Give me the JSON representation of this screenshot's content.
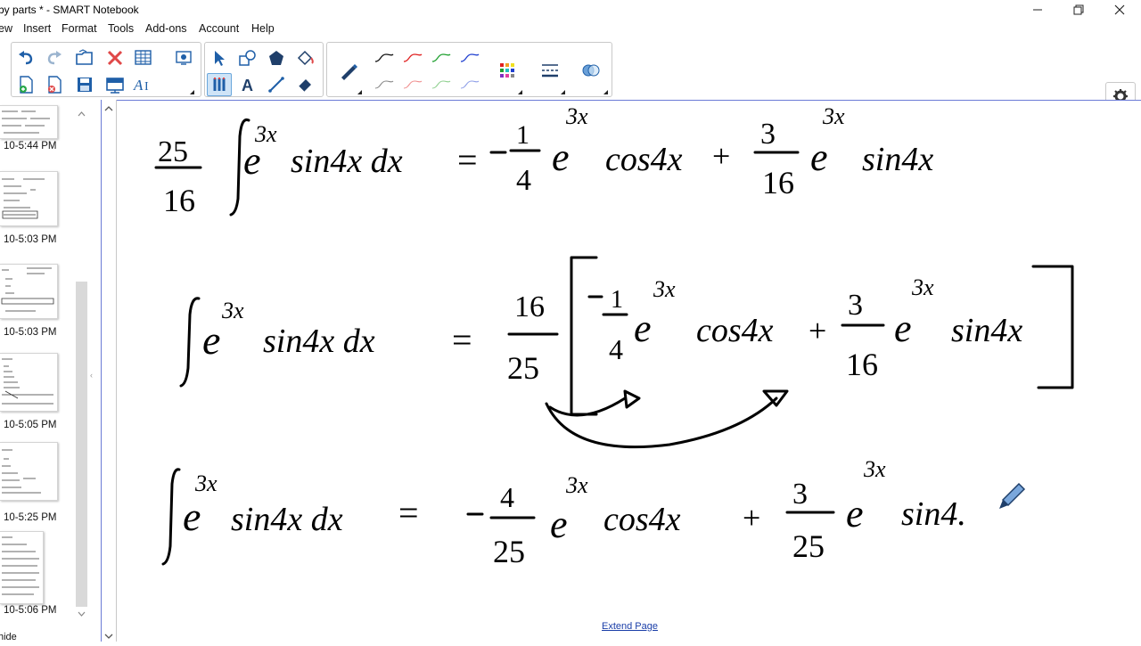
{
  "window": {
    "title": "by parts * - SMART Notebook",
    "controls": [
      "minimize",
      "restore",
      "close"
    ]
  },
  "menu": {
    "items": [
      "ew",
      "Insert",
      "Format",
      "Tools",
      "Add-ons",
      "Account",
      "Help"
    ]
  },
  "side_panel": {
    "thumbnails": [
      {
        "time": "10-5:44 PM"
      },
      {
        "time": "10-5:03 PM"
      },
      {
        "time": "10-5:03 PM"
      },
      {
        "time": "10-5:05 PM"
      },
      {
        "time": "10-5:25 PM"
      },
      {
        "time": "10-5:06 PM"
      }
    ],
    "hide_label": "hide"
  },
  "canvas": {
    "extend_page_label": "Extend Page"
  },
  "colors": {
    "accent_border": "#6b7bd6",
    "selected_tool": "#cfe4f7",
    "pen_red": "#e02020",
    "pen_green": "#20a030",
    "pen_blue": "#2040d0",
    "link": "#1a3ea8"
  }
}
